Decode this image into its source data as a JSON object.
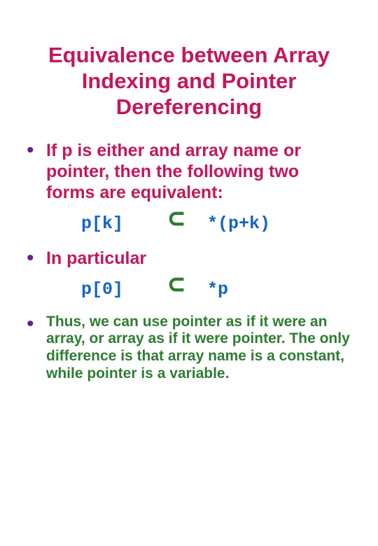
{
  "title": "Equivalence between Array Indexing and Pointer Dereferencing",
  "bullets": {
    "b0": "If p is either and array name or pointer, then the following two forms are equivalent:",
    "b1": "In particular",
    "b2": "Thus, we can use pointer as if it were an array, or array as if it were pointer.  The only difference is that array name is a constant, while pointer is a variable."
  },
  "equiv": {
    "row0": {
      "left": "p[k]",
      "sym": "⊂",
      "right": "*(p+k)"
    },
    "row1": {
      "left": "p[0]",
      "sym": "⊂",
      "right": "*p"
    }
  }
}
